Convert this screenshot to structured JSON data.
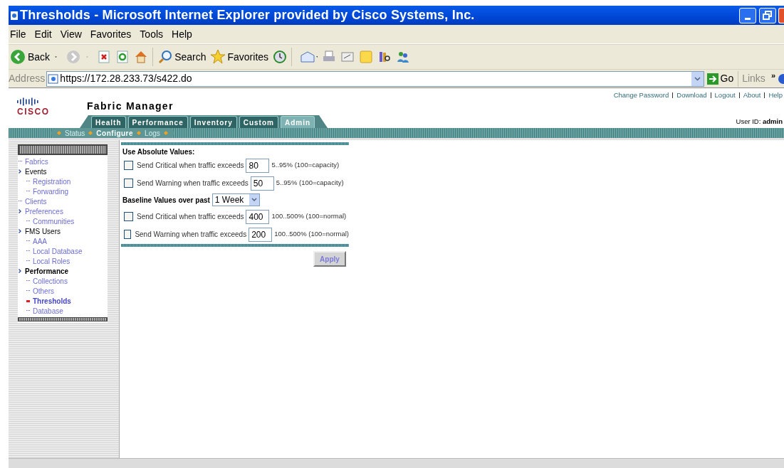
{
  "window": {
    "title": "Thresholds - Microsoft Internet Explorer provided by Cisco Systems, Inc."
  },
  "menu": [
    "File",
    "Edit",
    "View",
    "Favorites",
    "Tools",
    "Help"
  ],
  "toolbar": {
    "back": "Back",
    "search": "Search",
    "favorites": "Favorites"
  },
  "address": {
    "label": "Address",
    "value": "https://172.28.233.73/s422.do",
    "go": "Go",
    "links": "Links",
    "more": "»"
  },
  "header": {
    "logo": "CISCO",
    "app_title": "Fabric Manager",
    "top_links": [
      "Change Password",
      "Download",
      "Logout",
      "About",
      "Help"
    ],
    "user": "User ID: **admin**"
  },
  "tabs": [
    {
      "label": "Health",
      "selected": false
    },
    {
      "label": "Performance",
      "selected": false
    },
    {
      "label": "Inventory",
      "selected": false
    },
    {
      "label": "Custom",
      "selected": false
    },
    {
      "label": "Admin",
      "selected": true
    }
  ],
  "subnav": [
    {
      "label": "Status",
      "selected": false
    },
    {
      "label": "Configure",
      "selected": true
    },
    {
      "label": "Logs",
      "selected": false
    }
  ],
  "sidebar": {
    "items": [
      {
        "label": "Fabrics",
        "selected": false
      },
      {
        "label": "Events",
        "kind": "group",
        "children": [
          {
            "label": "Registration",
            "selected": false
          },
          {
            "label": "Forwarding",
            "selected": false
          }
        ]
      },
      {
        "label": "Clients",
        "selected": false
      },
      {
        "label": "Preferences",
        "kind": "link",
        "children": [
          {
            "label": "Communities",
            "selected": false
          }
        ]
      },
      {
        "label": "FMS Users",
        "kind": "group",
        "children": [
          {
            "label": "AAA",
            "selected": false
          },
          {
            "label": "Local Database",
            "selected": false
          },
          {
            "label": "Local Roles",
            "selected": false
          }
        ]
      },
      {
        "label": "Performance",
        "kind": "group",
        "children": [
          {
            "label": "Collections",
            "selected": false
          },
          {
            "label": "Others",
            "selected": false
          },
          {
            "label": "Thresholds",
            "selected": true
          },
          {
            "label": "Database",
            "selected": false
          }
        ]
      }
    ]
  },
  "form": {
    "absolute_heading": "Use Absolute Values:",
    "absolute_rows": [
      {
        "label": "Send Critical when traffic exceeds",
        "checked": false,
        "value": "80",
        "hint": "5..95% (100=capacity)"
      },
      {
        "label": "Send Warning when traffic exceeds",
        "checked": false,
        "value": "50",
        "hint": "5..95% (100=capacity)"
      }
    ],
    "baseline_label": "Baseline Values over past",
    "baseline_period": "1 Week",
    "baseline_rows": [
      {
        "label": "Send Critical when traffic exceeds",
        "checked": false,
        "value": "400",
        "hint": "100..500% (100=normal)"
      },
      {
        "label": "Send Warning when traffic exceeds",
        "checked": false,
        "value": "200",
        "hint": "100..500% (100=normal)"
      }
    ],
    "apply": "Apply"
  }
}
